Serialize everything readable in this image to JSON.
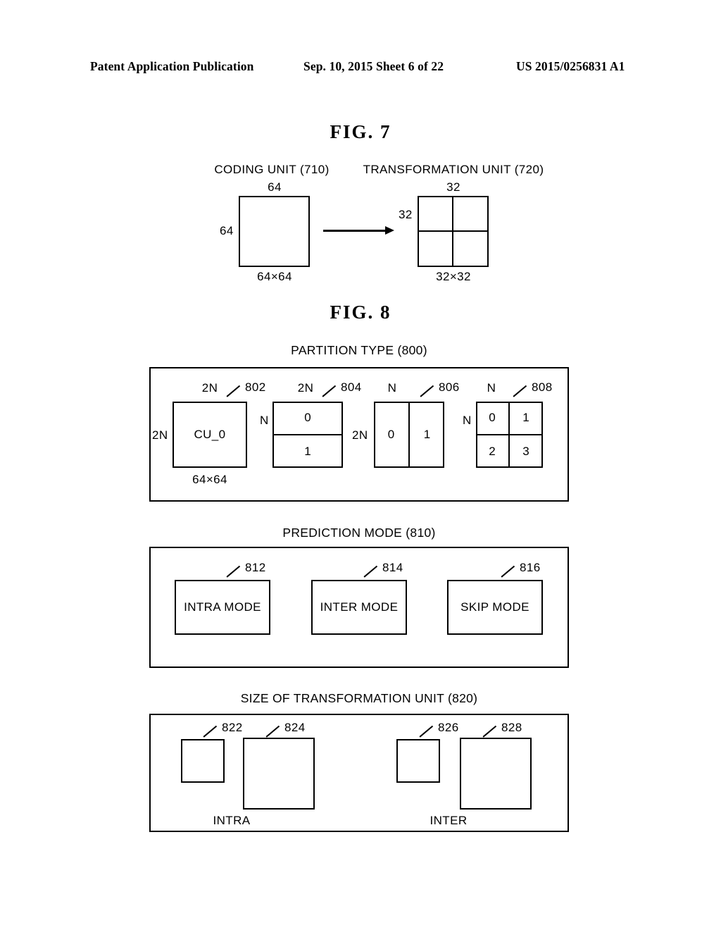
{
  "header": {
    "left": "Patent Application Publication",
    "middle": "Sep. 10, 2015  Sheet 6 of 22",
    "right": "US 2015/0256831 A1"
  },
  "fig7": {
    "title": "FIG.  7",
    "coding_unit_label": "CODING UNIT (710)",
    "transformation_unit_label": "TRANSFORMATION UNIT (720)",
    "cu_top": "64",
    "cu_left": "64",
    "cu_bottom": "64×64",
    "tu_top": "32",
    "tu_left": "32",
    "tu_bottom": "32×32"
  },
  "fig8": {
    "title": "FIG.  8",
    "partition_type": {
      "section_label": "PARTITION TYPE (800)",
      "items": [
        {
          "ref": "802",
          "top_label": "2N",
          "left_label": "2N",
          "bottom_label": "64×64",
          "cells": [
            "CU_0"
          ]
        },
        {
          "ref": "804",
          "top_label": "2N",
          "left_label": "N",
          "cells": [
            "0",
            "1"
          ]
        },
        {
          "ref": "806",
          "top_label": "N",
          "left_label": "2N",
          "cells": [
            "0",
            "1"
          ]
        },
        {
          "ref": "808",
          "top_label": "N",
          "left_label": "N",
          "cells": [
            "0",
            "1",
            "2",
            "3"
          ]
        }
      ]
    },
    "prediction_mode": {
      "section_label": "PREDICTION MODE (810)",
      "items": [
        {
          "ref": "812",
          "label": "INTRA MODE"
        },
        {
          "ref": "814",
          "label": "INTER MODE"
        },
        {
          "ref": "816",
          "label": "SKIP MODE"
        }
      ]
    },
    "transformation_unit_size": {
      "section_label": "SIZE OF TRANSFORMATION UNIT (820)",
      "groups": [
        {
          "caption": "INTRA",
          "items": [
            {
              "ref": "822"
            },
            {
              "ref": "824"
            }
          ]
        },
        {
          "caption": "INTER",
          "items": [
            {
              "ref": "826"
            },
            {
              "ref": "828"
            }
          ]
        }
      ]
    }
  }
}
